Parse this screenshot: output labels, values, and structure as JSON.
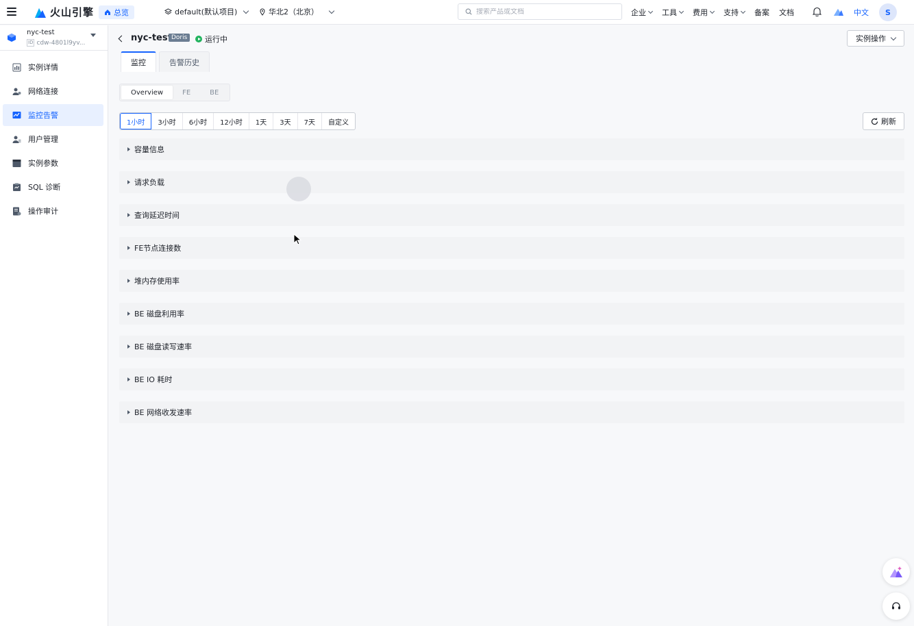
{
  "topbar": {
    "logo_text": "火山引擎",
    "home_label": "总览",
    "project": "default(默认项目)",
    "region": "华北2（北京）",
    "search_placeholder": "搜索产品或文档",
    "menu": [
      "企业",
      "工具",
      "费用",
      "支持",
      "备案",
      "文档"
    ],
    "lang": "中文",
    "avatar_initial": "S",
    "brand_color": "#1664ff"
  },
  "sidebar": {
    "instance_name": "nyc-test",
    "instance_id_tag": "ID",
    "instance_id": "cdw-4801l9yv...",
    "items": [
      {
        "label": "实例详情",
        "icon": "chart-icon",
        "active": false
      },
      {
        "label": "网络连接",
        "icon": "network-icon",
        "active": false
      },
      {
        "label": "监控告警",
        "icon": "monitor-icon",
        "active": true
      },
      {
        "label": "用户管理",
        "icon": "user-icon",
        "active": false
      },
      {
        "label": "实例参数",
        "icon": "params-icon",
        "active": false
      },
      {
        "label": "SQL 诊断",
        "icon": "sql-diagnose-icon",
        "active": false
      },
      {
        "label": "操作审计",
        "icon": "audit-icon",
        "active": false
      }
    ]
  },
  "header": {
    "title": "nyc-test",
    "engine_tag": "Doris",
    "status": "运行中",
    "ops_button": "实例操作"
  },
  "tabs": [
    {
      "label": "监控",
      "active": true
    },
    {
      "label": "告警历史",
      "active": false
    }
  ],
  "segments": [
    {
      "label": "Overview",
      "active": true
    },
    {
      "label": "FE",
      "active": false
    },
    {
      "label": "BE",
      "active": false
    }
  ],
  "time_ranges": [
    {
      "label": "1小时",
      "active": true
    },
    {
      "label": "3小时",
      "active": false
    },
    {
      "label": "6小时",
      "active": false
    },
    {
      "label": "12小时",
      "active": false
    },
    {
      "label": "1天",
      "active": false
    },
    {
      "label": "3天",
      "active": false
    },
    {
      "label": "7天",
      "active": false
    },
    {
      "label": "自定义",
      "active": false
    }
  ],
  "refresh_label": "刷新",
  "sections": [
    "容量信息",
    "请求负载",
    "查询延迟时间",
    "FE节点连接数",
    "堆内存使用率",
    "BE 磁盘利用率",
    "BE 磁盘读写速率",
    "BE IO 耗时",
    "BE 网络收发速率"
  ]
}
